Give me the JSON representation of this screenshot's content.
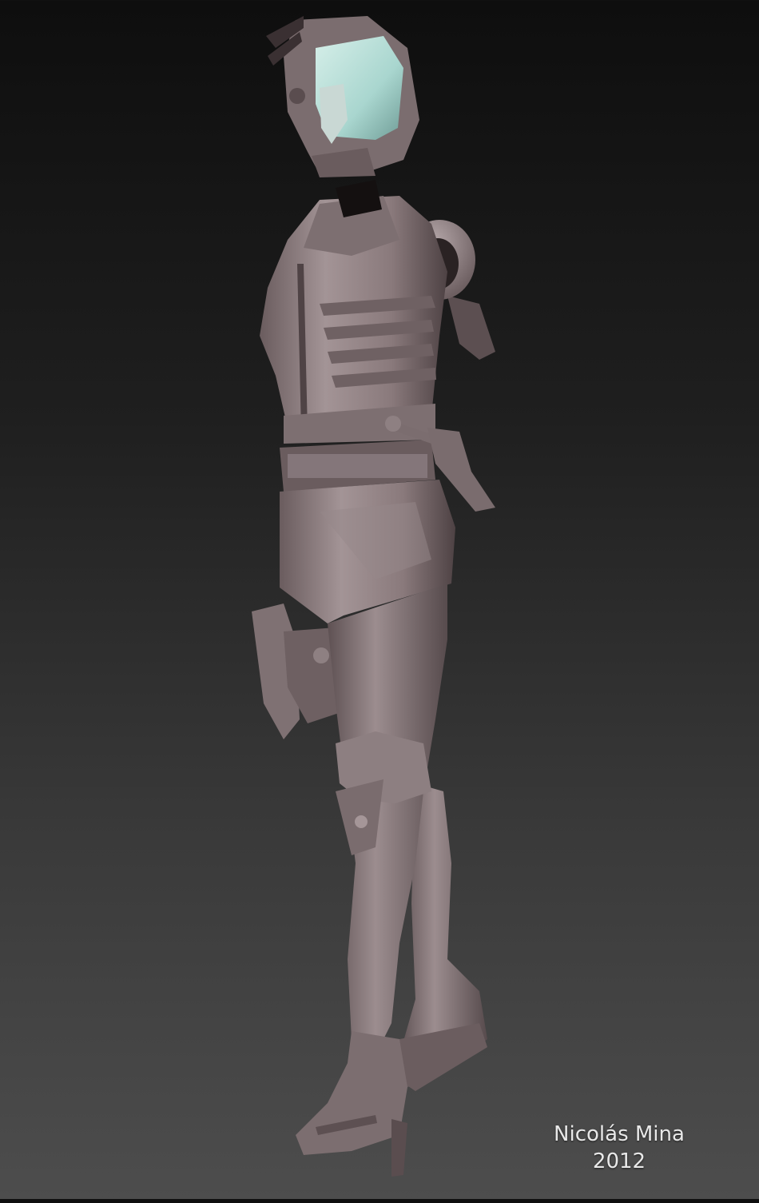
{
  "signature": {
    "author": "Nicolás Mina",
    "year": "2012"
  },
  "colors": {
    "background_top": "#0e0e0e",
    "background_bottom": "#4d4d4d",
    "sculpt_base": "#8a7a7c",
    "sculpt_shadow": "#4e4244",
    "visor": "#a9d6cf",
    "signature_text": "#e8e8e8"
  },
  "subject": {
    "icon": "armored-figure-sculpt"
  }
}
